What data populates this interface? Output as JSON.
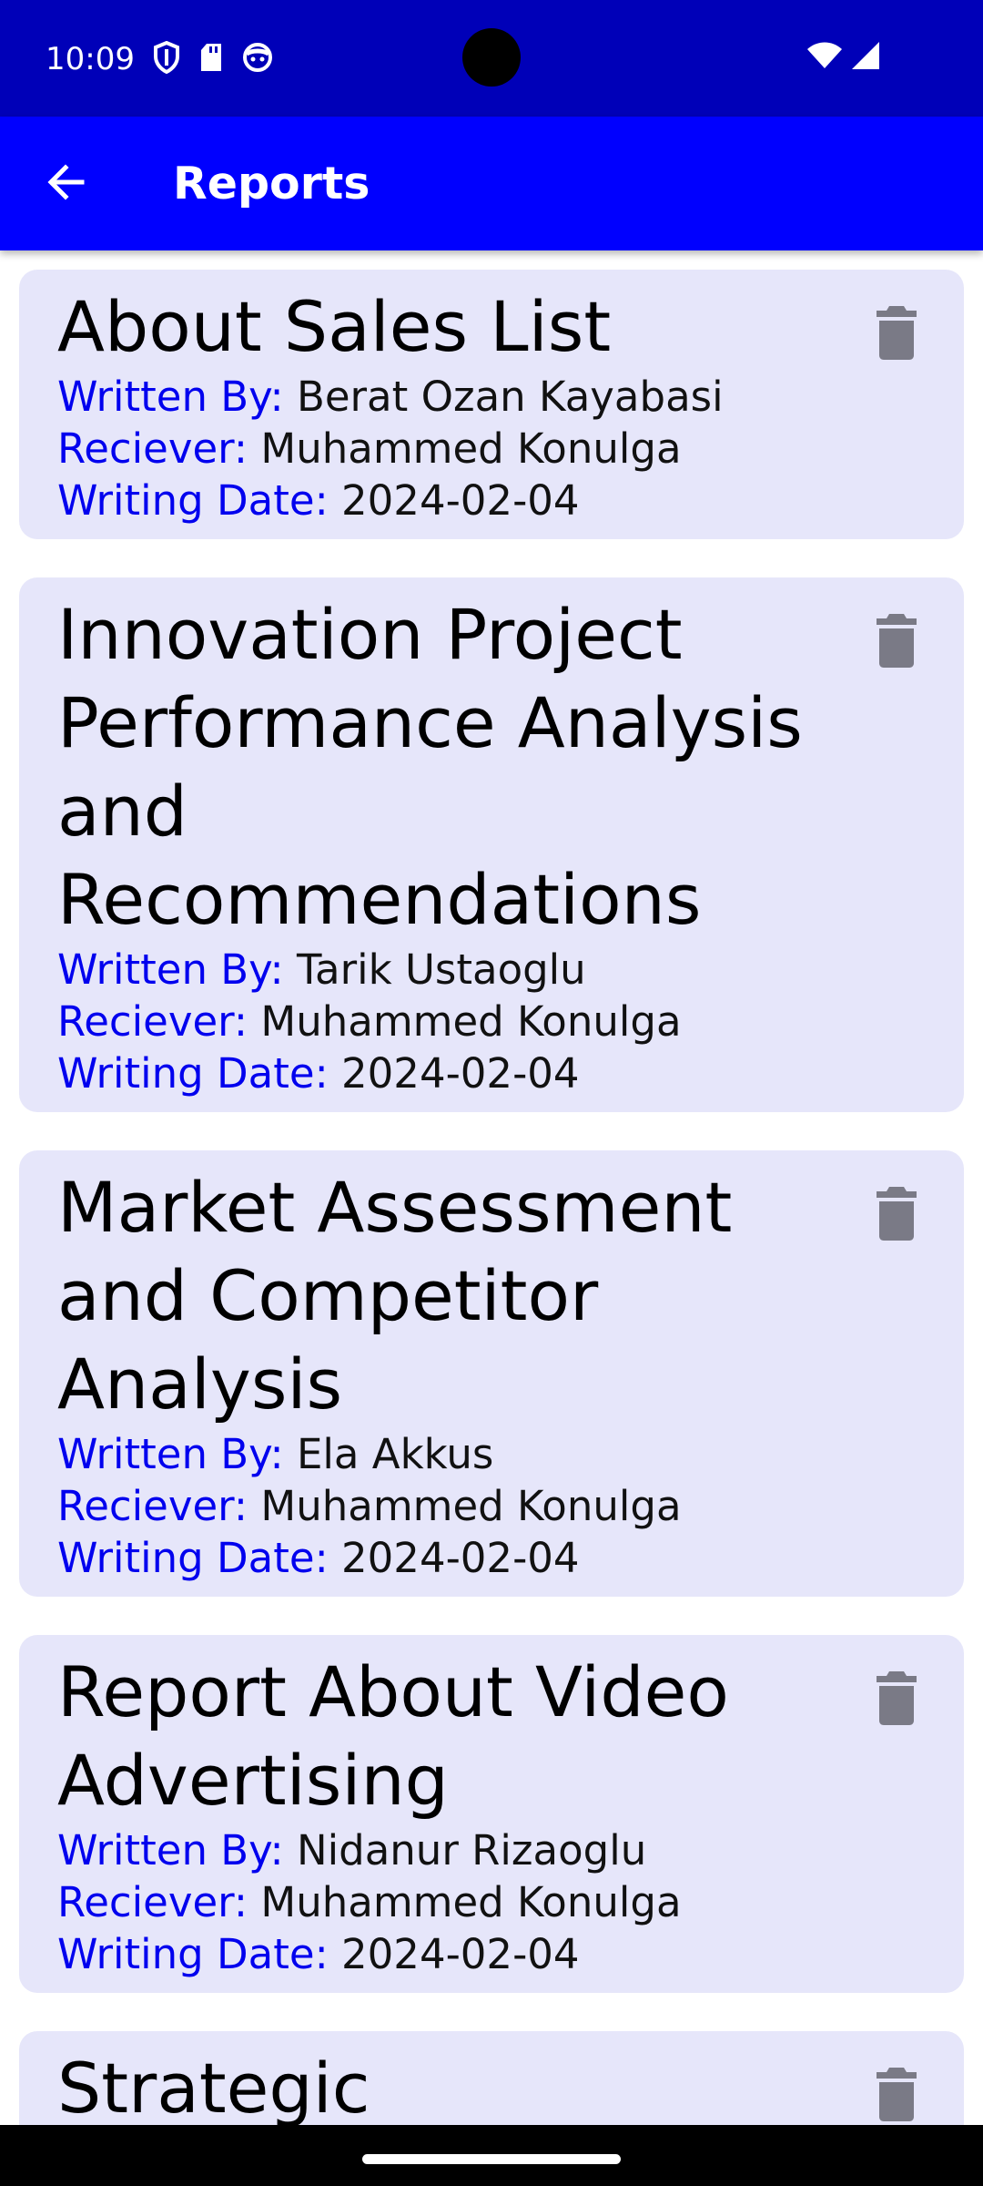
{
  "status_bar": {
    "time": "10:09",
    "background": "#0000b8",
    "left_icons": [
      "shield-icon",
      "sd-card-icon",
      "face-icon"
    ],
    "right_icons": [
      "wifi-icon",
      "cellular-signal-icon"
    ]
  },
  "app_bar": {
    "title": "Reports",
    "back_icon": "back-arrow-icon",
    "background": "#0000ff"
  },
  "colors": {
    "card_background": "#e6e6fa",
    "label_color": "#0000ee",
    "delete_icon": "#7a7a86"
  },
  "labels": {
    "written_by": "Written By:",
    "receiver": "Reciever:",
    "writing_date": "Writing Date:"
  },
  "reports": [
    {
      "title": "About Sales List",
      "written_by": "Berat Ozan Kayabasi",
      "receiver": "Muhammed Konulga",
      "date": "2024-02-04"
    },
    {
      "title": "Innovation Project Performance Analysis and Recommendations",
      "written_by": "Tarik Ustaoglu",
      "receiver": "Muhammed Konulga",
      "date": "2024-02-04"
    },
    {
      "title": "Market Assessment and Competitor Analysis",
      "written_by": "Ela Akkus",
      "receiver": "Muhammed Konulga",
      "date": "2024-02-04"
    },
    {
      "title": "Report About Video Advertising",
      "written_by": "Nidanur Rizaoglu",
      "receiver": "Muhammed Konulga",
      "date": "2024-02-04"
    },
    {
      "title": "Strategic",
      "written_by": "",
      "receiver": "",
      "date": ""
    }
  ]
}
